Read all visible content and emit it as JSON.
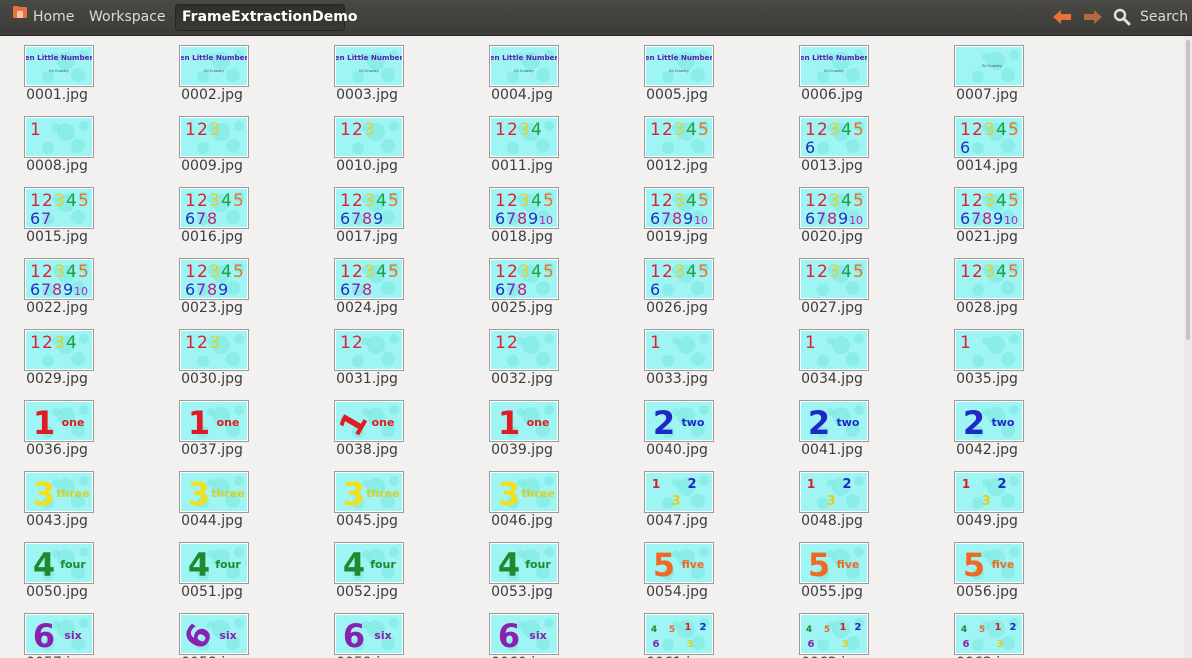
{
  "window": {
    "breadcrumb": {
      "home": "Home",
      "workspace": "Workspace",
      "current": "FrameExtractionDemo"
    },
    "search_label": "Search",
    "nav": {
      "back": "back-arrow-icon",
      "forward": "forward-arrow-icon"
    },
    "colors": {
      "topbar": "#3c3b37",
      "accent_orange": "#e8703a",
      "thumb_bg": "#9ff4f4",
      "background": "#f2f1f0"
    }
  },
  "files": [
    {
      "name": "0001.jpg",
      "thumb": "title"
    },
    {
      "name": "0002.jpg",
      "thumb": "title"
    },
    {
      "name": "0003.jpg",
      "thumb": "title"
    },
    {
      "name": "0004.jpg",
      "thumb": "title"
    },
    {
      "name": "0005.jpg",
      "thumb": "title"
    },
    {
      "name": "0006.jpg",
      "thumb": "title"
    },
    {
      "name": "0007.jpg",
      "thumb": "blank-title"
    },
    {
      "name": "0008.jpg",
      "thumb": "numbers",
      "n": 1
    },
    {
      "name": "0009.jpg",
      "thumb": "numbers",
      "n": 3
    },
    {
      "name": "0010.jpg",
      "thumb": "numbers",
      "n": 3
    },
    {
      "name": "0011.jpg",
      "thumb": "numbers",
      "n": 4
    },
    {
      "name": "0012.jpg",
      "thumb": "numbers",
      "n": 5
    },
    {
      "name": "0013.jpg",
      "thumb": "numbers",
      "n": 6
    },
    {
      "name": "0014.jpg",
      "thumb": "numbers",
      "n": 6
    },
    {
      "name": "0015.jpg",
      "thumb": "numbers",
      "n": 7
    },
    {
      "name": "0016.jpg",
      "thumb": "numbers",
      "n": 8
    },
    {
      "name": "0017.jpg",
      "thumb": "numbers",
      "n": 9
    },
    {
      "name": "0018.jpg",
      "thumb": "numbers",
      "n": 10
    },
    {
      "name": "0019.jpg",
      "thumb": "numbers",
      "n": 10
    },
    {
      "name": "0020.jpg",
      "thumb": "numbers",
      "n": 10
    },
    {
      "name": "0021.jpg",
      "thumb": "numbers",
      "n": 10
    },
    {
      "name": "0022.jpg",
      "thumb": "numbers",
      "n": 10
    },
    {
      "name": "0023.jpg",
      "thumb": "numbers",
      "n": 9
    },
    {
      "name": "0024.jpg",
      "thumb": "numbers",
      "n": 8
    },
    {
      "name": "0025.jpg",
      "thumb": "numbers",
      "n": 8
    },
    {
      "name": "0026.jpg",
      "thumb": "numbers",
      "n": 6
    },
    {
      "name": "0027.jpg",
      "thumb": "numbers",
      "n": 5
    },
    {
      "name": "0028.jpg",
      "thumb": "numbers",
      "n": 5
    },
    {
      "name": "0029.jpg",
      "thumb": "numbers",
      "n": 4
    },
    {
      "name": "0030.jpg",
      "thumb": "numbers",
      "n": 3
    },
    {
      "name": "0031.jpg",
      "thumb": "numbers",
      "n": 2
    },
    {
      "name": "0032.jpg",
      "thumb": "numbers",
      "n": 2
    },
    {
      "name": "0033.jpg",
      "thumb": "numbers",
      "n": 1
    },
    {
      "name": "0034.jpg",
      "thumb": "numbers",
      "n": 1
    },
    {
      "name": "0035.jpg",
      "thumb": "numbers",
      "n": 1
    },
    {
      "name": "0036.jpg",
      "thumb": "word",
      "d": "1",
      "w": "one",
      "c": "#e01b24",
      "wc": "#e01b24"
    },
    {
      "name": "0037.jpg",
      "thumb": "word",
      "d": "1",
      "w": "one",
      "c": "#e01b24",
      "wc": "#e01b24"
    },
    {
      "name": "0038.jpg",
      "thumb": "word",
      "d": "1",
      "w": "one",
      "c": "#e01b24",
      "wc": "#e01b24",
      "tilt": true
    },
    {
      "name": "0039.jpg",
      "thumb": "word",
      "d": "1",
      "w": "one",
      "c": "#e01b24",
      "wc": "#e01b24"
    },
    {
      "name": "0040.jpg",
      "thumb": "word",
      "d": "2",
      "w": "two",
      "c": "#1c28c8",
      "wc": "#1c28c8"
    },
    {
      "name": "0041.jpg",
      "thumb": "word",
      "d": "2",
      "w": "two",
      "c": "#1c28c8",
      "wc": "#1c28c8"
    },
    {
      "name": "0042.jpg",
      "thumb": "word",
      "d": "2",
      "w": "two",
      "c": "#1c28c8",
      "wc": "#1c28c8"
    },
    {
      "name": "0043.jpg",
      "thumb": "word",
      "d": "3",
      "w": "three",
      "c": "#f0e020",
      "wc": "#d8d020"
    },
    {
      "name": "0044.jpg",
      "thumb": "word",
      "d": "3",
      "w": "three",
      "c": "#f0e020",
      "wc": "#d8d020"
    },
    {
      "name": "0045.jpg",
      "thumb": "word",
      "d": "3",
      "w": "three",
      "c": "#f0e020",
      "wc": "#d8d020"
    },
    {
      "name": "0046.jpg",
      "thumb": "word",
      "d": "3",
      "w": "three",
      "c": "#f0e020",
      "wc": "#d8d020"
    },
    {
      "name": "0047.jpg",
      "thumb": "mix3"
    },
    {
      "name": "0048.jpg",
      "thumb": "mix3"
    },
    {
      "name": "0049.jpg",
      "thumb": "mix3"
    },
    {
      "name": "0050.jpg",
      "thumb": "word",
      "d": "4",
      "w": "four",
      "c": "#1e8a2e",
      "wc": "#1e8a2e"
    },
    {
      "name": "0051.jpg",
      "thumb": "word",
      "d": "4",
      "w": "four",
      "c": "#1e8a2e",
      "wc": "#1e8a2e"
    },
    {
      "name": "0052.jpg",
      "thumb": "word",
      "d": "4",
      "w": "four",
      "c": "#1e8a2e",
      "wc": "#1e8a2e"
    },
    {
      "name": "0053.jpg",
      "thumb": "word",
      "d": "4",
      "w": "four",
      "c": "#1e8a2e",
      "wc": "#1e8a2e"
    },
    {
      "name": "0054.jpg",
      "thumb": "word",
      "d": "5",
      "w": "five",
      "c": "#ee6a22",
      "wc": "#ee6a22"
    },
    {
      "name": "0055.jpg",
      "thumb": "word",
      "d": "5",
      "w": "five",
      "c": "#ee6a22",
      "wc": "#ee6a22"
    },
    {
      "name": "0056.jpg",
      "thumb": "word",
      "d": "5",
      "w": "five",
      "c": "#ee6a22",
      "wc": "#ee6a22"
    },
    {
      "name": "0057.jpg",
      "thumb": "word",
      "d": "6",
      "w": "six",
      "c": "#8a1fb0",
      "wc": "#8a1fb0"
    },
    {
      "name": "0058.jpg",
      "thumb": "word",
      "d": "6",
      "w": "six",
      "c": "#8a1fb0",
      "wc": "#8a1fb0",
      "tilt": true
    },
    {
      "name": "0059.jpg",
      "thumb": "word",
      "d": "6",
      "w": "six",
      "c": "#8a1fb0",
      "wc": "#8a1fb0"
    },
    {
      "name": "0060.jpg",
      "thumb": "word",
      "d": "6",
      "w": "six",
      "c": "#8a1fb0",
      "wc": "#8a1fb0"
    },
    {
      "name": "0061.jpg",
      "thumb": "mix6"
    },
    {
      "name": "0062.jpg",
      "thumb": "mix6"
    },
    {
      "name": "0063.jpg",
      "thumb": "mix6"
    }
  ],
  "thumb_text": {
    "title": "Ten Little Numbers",
    "credit": "Ed Crowley",
    "digits": [
      "1",
      "2",
      "3",
      "4",
      "5",
      "6",
      "7",
      "8",
      "9",
      "10"
    ],
    "digit_colors": [
      "#e02030",
      "#e02030",
      "#e8d020",
      "#20a040",
      "#f07020",
      "#2030c0",
      "#8020c0",
      "#c02080",
      "#2030c0",
      "#c020c0"
    ]
  }
}
